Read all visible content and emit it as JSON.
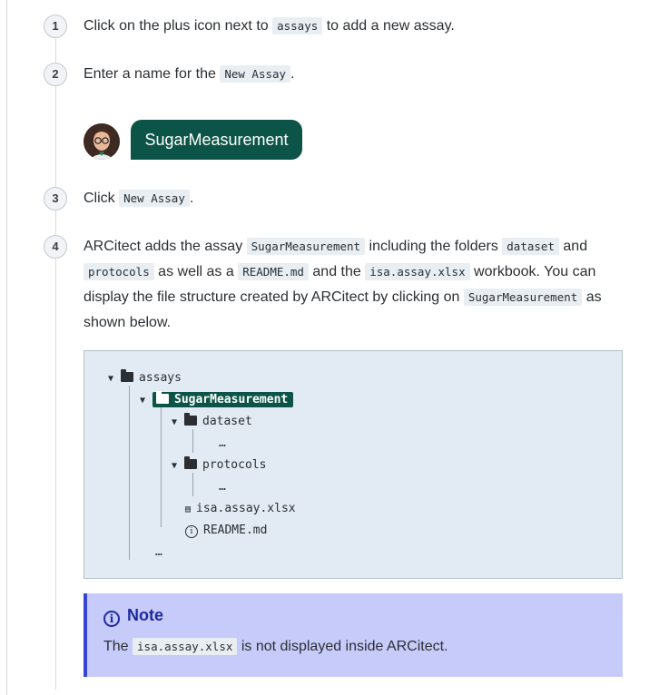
{
  "steps": [
    {
      "num": "1",
      "parts": [
        "Click on the plus icon next to ",
        "assays",
        " to add a new assay."
      ]
    },
    {
      "num": "2",
      "parts": [
        "Enter a name for the ",
        "New Assay",
        "."
      ]
    },
    {
      "num": "3",
      "parts": [
        "Click ",
        "New Assay",
        "."
      ]
    },
    {
      "num": "4",
      "parts": [
        "ARCitect adds the assay ",
        "SugarMeasurement",
        " including the folders ",
        "dataset",
        " and ",
        "protocols",
        " as well as a ",
        "README.md",
        " and the ",
        "isa.assay.xlsx",
        " workbook. You can display the file structure created by ARCitect by clicking on ",
        "SugarMeasurement",
        " as shown below."
      ]
    }
  ],
  "chat": {
    "bubble_text": "SugarMeasurement"
  },
  "tree": {
    "root": "assays",
    "child": "SugarMeasurement",
    "dataset": "dataset",
    "protocols": "protocols",
    "ellipsis": "…",
    "xlsx": "isa.assay.xlsx",
    "readme": "README.md"
  },
  "note": {
    "title": "Note",
    "parts": [
      "The ",
      "isa.assay.xlsx",
      " is not displayed inside ARCitect."
    ]
  },
  "icons": {
    "note": "info-icon",
    "folder": "folder-icon",
    "file": "excel-file-icon",
    "readme": "info-circle-icon"
  }
}
